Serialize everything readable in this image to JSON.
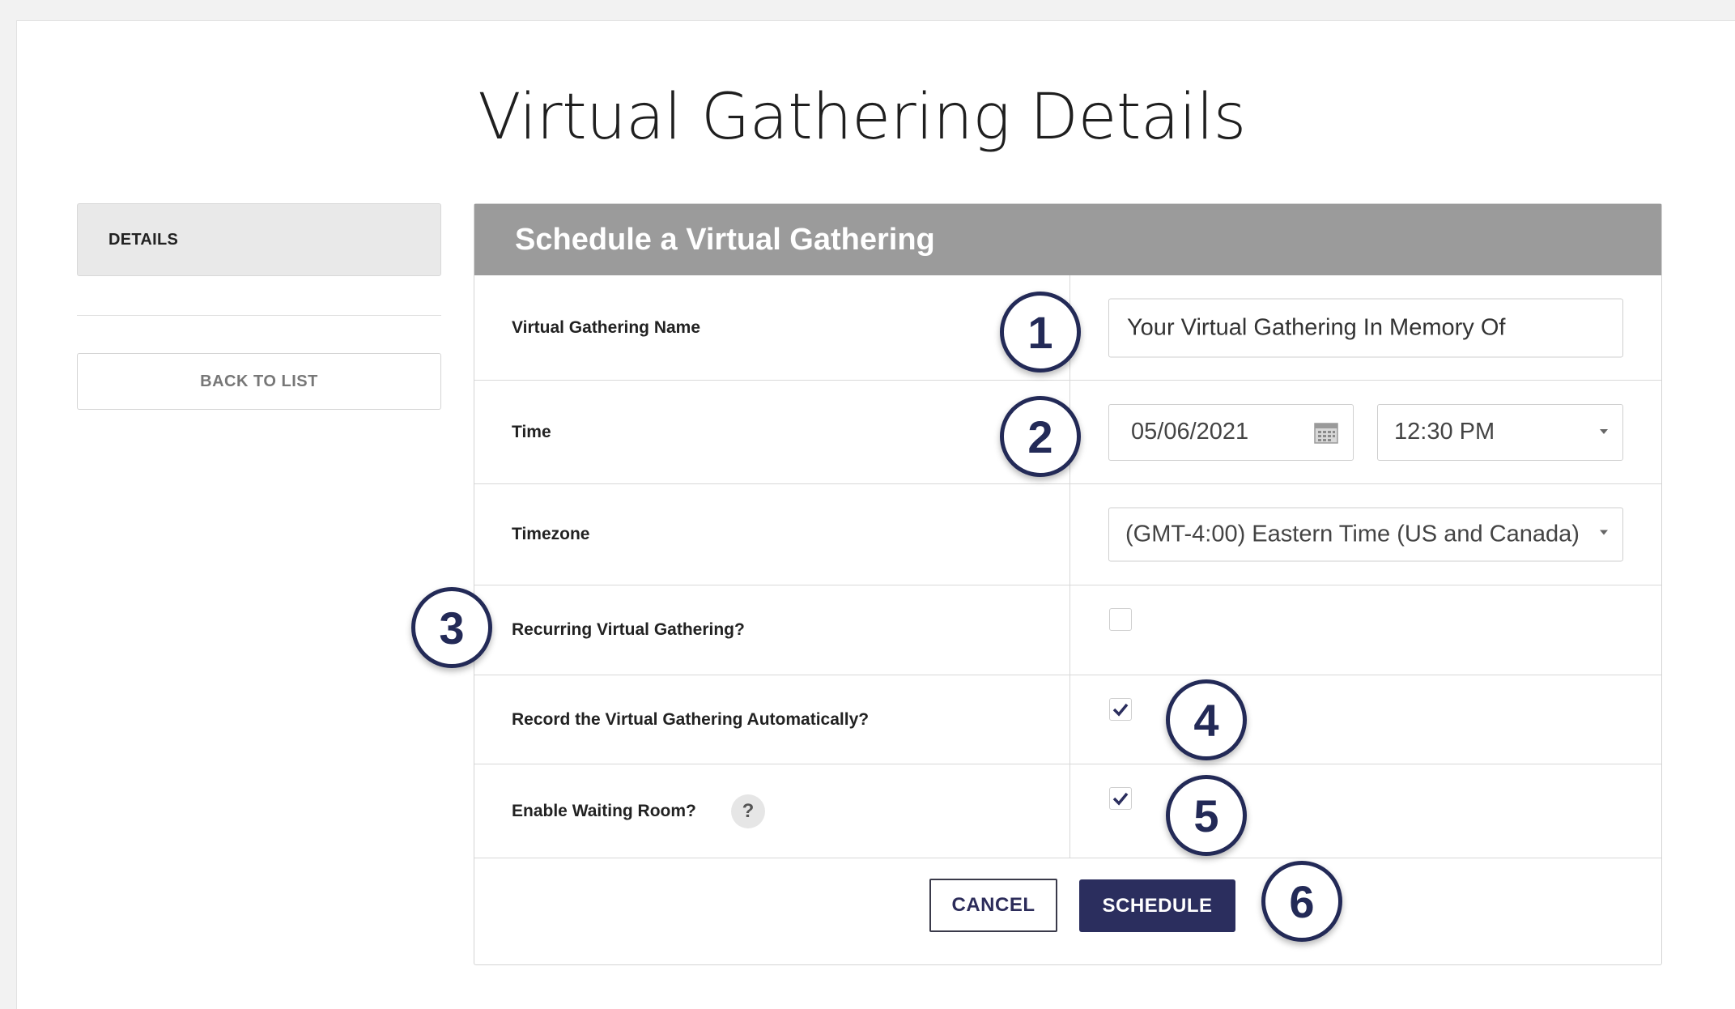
{
  "page": {
    "title": "Virtual Gathering Details"
  },
  "sidebar": {
    "details_label": "DETAILS",
    "back_label": "BACK TO LIST"
  },
  "panel": {
    "header": "Schedule a Virtual Gathering",
    "name": {
      "label": "Virtual Gathering Name",
      "value": "Your Virtual Gathering In Memory Of"
    },
    "time": {
      "label": "Time",
      "date": "05/06/2021",
      "time": "12:30 PM"
    },
    "timezone": {
      "label": "Timezone",
      "value": "(GMT-4:00) Eastern Time (US and Canada)"
    },
    "recurring": {
      "label": "Recurring Virtual Gathering?",
      "checked": false
    },
    "record": {
      "label": "Record the Virtual Gathering Automatically?",
      "checked": true
    },
    "waiting": {
      "label": "Enable Waiting Room?",
      "checked": true,
      "help": "?"
    },
    "cancel_label": "CANCEL",
    "schedule_label": "SCHEDULE"
  },
  "callouts": [
    "1",
    "2",
    "3",
    "4",
    "5",
    "6"
  ],
  "colors": {
    "header_bg": "#9b9b9b",
    "primary": "#2b2e5e",
    "callout": "#232a57"
  }
}
